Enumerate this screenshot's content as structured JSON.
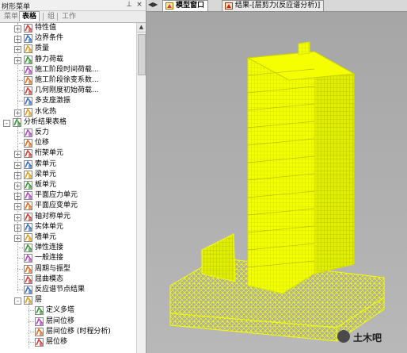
{
  "left_panel": {
    "title": "树形菜单",
    "pin_icon": "pin-icon",
    "close_icon": "close-icon",
    "tabs": [
      {
        "label": "菜单",
        "active": false
      },
      {
        "label": "表格",
        "active": true
      },
      {
        "label": "组",
        "active": false
      },
      {
        "label": "工作",
        "active": false
      }
    ]
  },
  "tree": {
    "items": [
      {
        "label": "特性值",
        "indent": 1,
        "expander": "+",
        "icon": "eigen-icon"
      },
      {
        "label": "边界条件",
        "indent": 1,
        "expander": "+",
        "icon": "boundary-icon"
      },
      {
        "label": "质量",
        "indent": 1,
        "expander": "+",
        "icon": "mass-icon"
      },
      {
        "label": "静力荷载",
        "indent": 1,
        "expander": "+",
        "icon": "static-load-icon"
      },
      {
        "label": "施工阶段时间荷载...",
        "indent": 1,
        "expander": "",
        "icon": "construction-time-icon"
      },
      {
        "label": "施工阶段徐变系数...",
        "indent": 1,
        "expander": "",
        "icon": "creep-icon"
      },
      {
        "label": "几何刚度初始荷载...",
        "indent": 1,
        "expander": "",
        "icon": "geometric-stiffness-icon"
      },
      {
        "label": "多支座激振",
        "indent": 1,
        "expander": "",
        "icon": "multi-support-icon"
      },
      {
        "label": "水化热",
        "indent": 1,
        "expander": "+",
        "icon": "hydration-heat-icon"
      },
      {
        "label": "分析结果表格",
        "indent": 0,
        "expander": "-",
        "icon": "result-table-icon"
      },
      {
        "label": "反力",
        "indent": 1,
        "expander": "",
        "icon": "reaction-icon"
      },
      {
        "label": "位移",
        "indent": 1,
        "expander": "",
        "icon": "displacement-icon"
      },
      {
        "label": "桁架单元",
        "indent": 1,
        "expander": "+",
        "icon": "truss-icon"
      },
      {
        "label": "索单元",
        "indent": 1,
        "expander": "+",
        "icon": "cable-icon"
      },
      {
        "label": "梁单元",
        "indent": 1,
        "expander": "+",
        "icon": "beam-icon"
      },
      {
        "label": "板单元",
        "indent": 1,
        "expander": "+",
        "icon": "plate-icon"
      },
      {
        "label": "平面应力单元",
        "indent": 1,
        "expander": "+",
        "icon": "plane-stress-icon"
      },
      {
        "label": "平面应变单元",
        "indent": 1,
        "expander": "+",
        "icon": "plane-strain-icon"
      },
      {
        "label": "轴对称单元",
        "indent": 1,
        "expander": "+",
        "icon": "axisymmetric-icon"
      },
      {
        "label": "实体单元",
        "indent": 1,
        "expander": "+",
        "icon": "solid-icon"
      },
      {
        "label": "墙单元",
        "indent": 1,
        "expander": "+",
        "icon": "wall-icon"
      },
      {
        "label": "弹性连接",
        "indent": 1,
        "expander": "",
        "icon": "elastic-link-icon"
      },
      {
        "label": "一般连接",
        "indent": 1,
        "expander": "",
        "icon": "general-link-icon"
      },
      {
        "label": "周期与振型",
        "indent": 1,
        "expander": "",
        "icon": "vibration-mode-icon"
      },
      {
        "label": "屈曲模态",
        "indent": 1,
        "expander": "",
        "icon": "buckling-icon"
      },
      {
        "label": "反应谱节点结果",
        "indent": 1,
        "expander": "",
        "icon": "spectrum-node-icon"
      },
      {
        "label": "层",
        "indent": 1,
        "expander": "-",
        "icon": "story-icon"
      },
      {
        "label": "定义多塔",
        "indent": 2,
        "expander": "",
        "icon": "multi-tower-icon"
      },
      {
        "label": "层间位移",
        "indent": 2,
        "expander": "",
        "icon": "story-drift-icon"
      },
      {
        "label": "层间位移 (时程分析)",
        "indent": 2,
        "expander": "",
        "icon": "story-drift-th-icon"
      },
      {
        "label": "层位移",
        "indent": 2,
        "expander": "",
        "icon": "story-displacement-icon"
      }
    ]
  },
  "doc_tabs": [
    {
      "label": "模型窗口",
      "active": true,
      "icon": "model-window-icon"
    },
    {
      "label": "结果-[层剪力(反应谱分析)]",
      "active": false,
      "icon": "result-window-icon"
    }
  ],
  "nav_arrows": "◀▶",
  "viewport": {
    "model_color": "#f5ff00",
    "background": "#a8a8a8"
  },
  "watermark": {
    "text": "土木吧",
    "icon": "wechat-logo-icon"
  }
}
